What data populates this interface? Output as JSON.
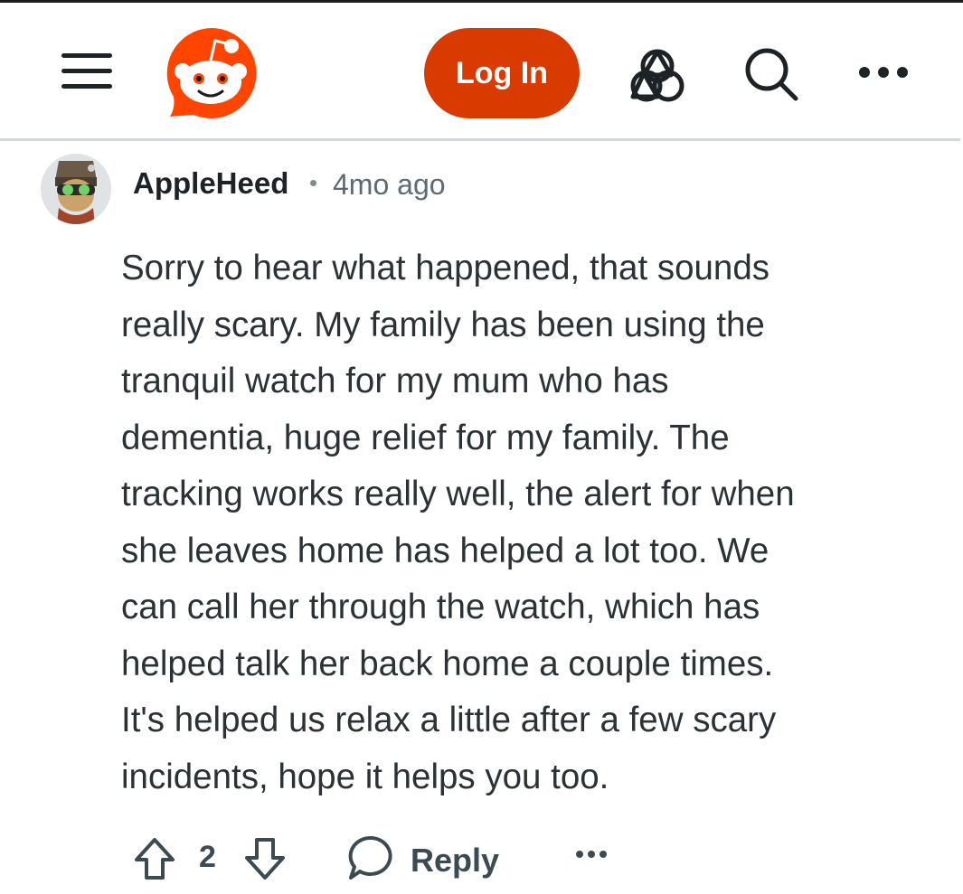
{
  "header": {
    "menu_icon": "hamburger-menu-icon",
    "logo_icon": "reddit-snoo-logo-icon",
    "login_label": "Log In",
    "advertise_icon": "advertise-icon",
    "search_icon": "search-icon",
    "more_icon": "more-options-icon",
    "brand_color": "#d93a00"
  },
  "comment": {
    "author": "AppleHeed",
    "time": "4mo ago",
    "avatar_icon": "user-avatar",
    "lines": [
      "Sorry to hear what happened, that sounds",
      "really scary. My family has been using the",
      "tranquil watch for my mum who has",
      "dementia, huge relief for my family. The",
      "tracking works really well, the alert for when",
      "she leaves home has helped a lot too. We",
      "can call her through the watch, which has",
      "helped talk her back home a couple times.",
      "It's helped us relax a little after a few scary",
      "incidents, hope it helps you too."
    ],
    "vote_count": "2",
    "reply_label": "Reply",
    "upvote_icon": "upvote-arrow-icon",
    "downvote_icon": "downvote-arrow-icon",
    "reply_icon": "speech-bubble-icon",
    "more_icon": "more-options-icon"
  }
}
